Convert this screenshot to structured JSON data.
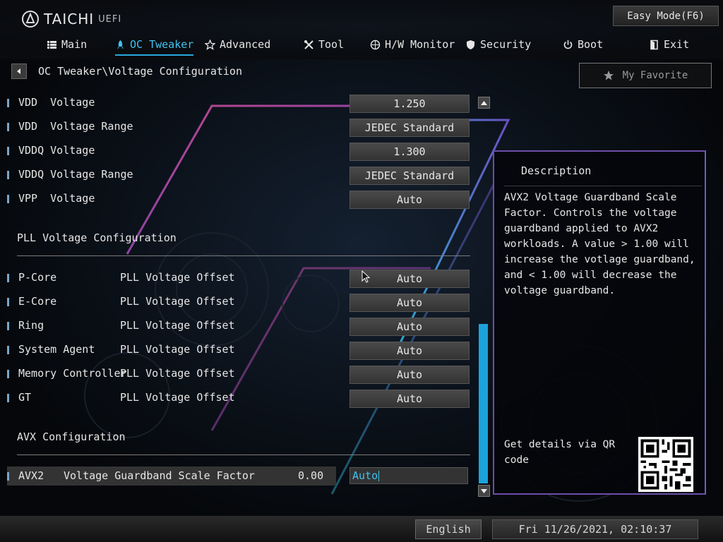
{
  "brand": {
    "name": "TAICHI",
    "suffix": "UEFI"
  },
  "easy_mode_label": "Easy Mode(F6)",
  "nav": [
    {
      "label": "Main",
      "icon": "list-icon"
    },
    {
      "label": "OC Tweaker",
      "icon": "rocket-icon",
      "active": true
    },
    {
      "label": "Advanced",
      "icon": "star-icon"
    },
    {
      "label": "Tool",
      "icon": "tools-icon"
    },
    {
      "label": "H/W Monitor",
      "icon": "monitor-icon"
    },
    {
      "label": "Security",
      "icon": "shield-icon"
    },
    {
      "label": "Boot",
      "icon": "power-icon"
    },
    {
      "label": "Exit",
      "icon": "exit-icon"
    }
  ],
  "breadcrumb": "OC Tweaker\\Voltage Configuration",
  "favorite_label": "My Favorite",
  "voltage_rows": [
    {
      "label": "VDD  Voltage",
      "value": "1.250"
    },
    {
      "label": "VDD  Voltage Range",
      "value": "JEDEC Standard"
    },
    {
      "label": "VDDQ Voltage",
      "value": "1.300"
    },
    {
      "label": "VDDQ Voltage Range",
      "value": "JEDEC Standard"
    },
    {
      "label": "VPP  Voltage",
      "value": "Auto"
    }
  ],
  "pll_section": "PLL Voltage Configuration",
  "pll_rows": [
    {
      "name": "P-Core",
      "label": "PLL Voltage Offset",
      "value": "Auto"
    },
    {
      "name": "E-Core",
      "label": "PLL Voltage Offset",
      "value": "Auto"
    },
    {
      "name": "Ring",
      "label": "PLL Voltage Offset",
      "value": "Auto"
    },
    {
      "name": "System Agent",
      "label": "PLL Voltage Offset",
      "value": "Auto"
    },
    {
      "name": "Memory Controller",
      "label": "PLL Voltage Offset",
      "value": "Auto"
    },
    {
      "name": "GT",
      "label": "PLL Voltage Offset",
      "value": "Auto"
    }
  ],
  "avx_section": "AVX Configuration",
  "avx_row": {
    "name": "AVX2",
    "label": "Voltage Guardband Scale Factor",
    "current": "0.00",
    "value": "Auto"
  },
  "description": {
    "title": "Description",
    "body": "AVX2 Voltage Guardband Scale Factor. Controls the voltage guardband applied to AVX2 workloads. A value > 1.00 will increase the votlage guardband, and < 1.00 will decrease the voltage guardband.",
    "qr_text": "Get details via QR code"
  },
  "footer": {
    "language": "English",
    "datetime": "Fri 11/26/2021, 02:10:37"
  },
  "colors": {
    "accent": "#3fc3f0",
    "scrollbar": "#1ba3dc",
    "panel_border": "#6b4ea8"
  }
}
